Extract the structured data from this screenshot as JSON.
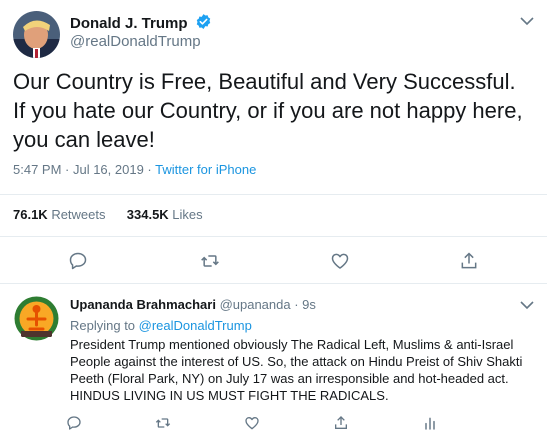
{
  "tweet": {
    "author_name": "Donald J. Trump",
    "author_handle": "@realDonaldTrump",
    "text": "Our Country is Free, Beautiful and Very Successful. If you hate our Country, or if you are not happy here, you can leave!",
    "time": "5:47 PM · Jul 16, 2019",
    "separator": " · ",
    "source": "Twitter for iPhone",
    "retweets_count": "76.1K",
    "retweets_label": " Retweets",
    "likes_count": "334.5K",
    "likes_label": " Likes"
  },
  "reply": {
    "author_name": "Upananda Brahmachari",
    "author_handle": "@upananda",
    "time": "9s",
    "replying_prefix": "Replying to ",
    "replying_to": "@realDonaldTrump",
    "lines": [
      "President Trump mentioned obviously The Radical Left, Muslims & anti-Israel",
      "People against the interest of US. So, the attack on Hindu Preist of Shiv Shakti",
      "Peeth (Floral Park, NY) on July 17 was an irresponsible and hot-headed act.",
      "HINDUS LIVING IN US MUST FIGHT THE RADICALS."
    ]
  },
  "colors": {
    "accent": "#1b95e0",
    "verified": "#1da1f2",
    "secondary_text": "#657786",
    "icon_gray": "#657786"
  },
  "icons": [
    "verified-badge-icon",
    "chevron-down-icon",
    "reply-icon",
    "retweet-icon",
    "like-icon",
    "share-icon",
    "analytics-icon"
  ]
}
